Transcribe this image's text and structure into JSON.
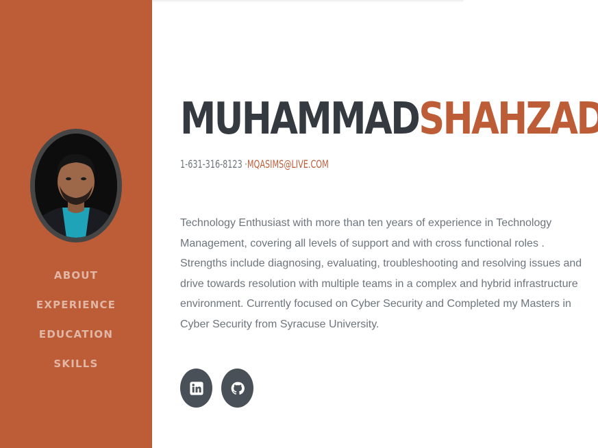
{
  "profile": {
    "first_name": "MUHAMMAD",
    "last_name": "SHAHZAD",
    "phone": "1-631-316-8123",
    "separator": " ·",
    "email": "MQASIMS@LIVE.COM",
    "bio": "Technology Enthusiast with more than ten years of experience in Technology Management, covering all levels of support and with cross functional roles . Strengths include diagnosing, evaluating, troubleshooting and resolving issues and drive towards resolution with multiple teams in a complex and hybrid infrastructure environment. Currently focused on Cyber Security and Completed my Masters in Cyber Security from Syracuse University."
  },
  "nav": {
    "items": [
      {
        "label": "ABOUT"
      },
      {
        "label": "EXPERIENCE"
      },
      {
        "label": "EDUCATION"
      },
      {
        "label": "SKILLS"
      }
    ]
  },
  "social": {
    "items": [
      {
        "icon": "linkedin-icon"
      },
      {
        "icon": "github-icon"
      }
    ]
  },
  "colors": {
    "accent": "#bd5d38",
    "dark": "#343a40",
    "muted": "#6c757d",
    "social_bg": "#495057"
  }
}
